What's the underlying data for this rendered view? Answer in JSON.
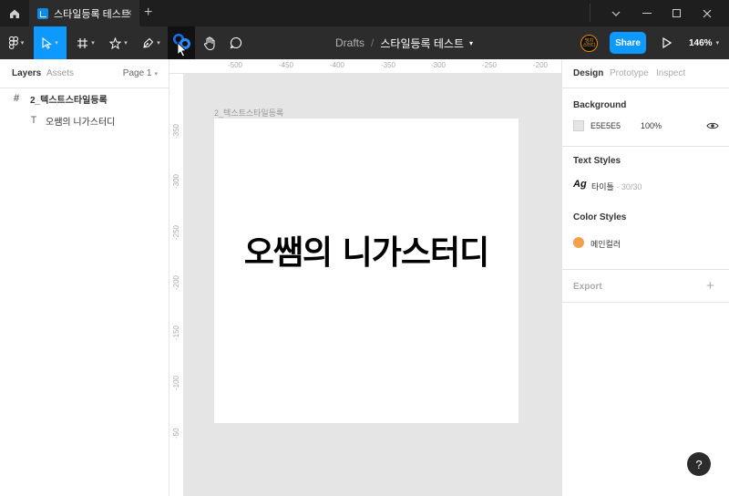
{
  "titlebar": {
    "tab_title": "스타일등록 테스트",
    "tab_close": "×",
    "new_tab": "+"
  },
  "toolbar": {
    "breadcrumb_parent": "Drafts",
    "breadcrumb_separator": "/",
    "file_name": "스타일등록 테스트",
    "avatar_text": "밍치\n스터디",
    "share_label": "Share",
    "zoom_label": "146%"
  },
  "left_panel": {
    "tabs": [
      "Layers",
      "Assets"
    ],
    "page_label": "Page 1",
    "layers": [
      {
        "name": "2_텍스트스타일등록",
        "icon": "#",
        "kind": "frame"
      },
      {
        "name": "오쌤의 니가스터디",
        "icon": "T",
        "kind": "text"
      }
    ]
  },
  "canvas": {
    "ruler_top": [
      "-500",
      "-450",
      "-400",
      "-350",
      "-300",
      "-250",
      "-200"
    ],
    "ruler_left": [
      "-350",
      "-300",
      "-250",
      "-200",
      "-150",
      "-100",
      "-50"
    ],
    "frame_label": "2_텍스트스타일등록",
    "frame_text": "오쌤의 니가스터디"
  },
  "right_panel": {
    "tabs": [
      "Design",
      "Prototype",
      "Inspect"
    ],
    "background": {
      "title": "Background",
      "hex": "E5E5E5",
      "opacity": "100%",
      "color": "#E5E5E5"
    },
    "text_styles": {
      "title": "Text Styles",
      "icon_text": "Ag",
      "style_name": "타이틀",
      "style_meta": " · 30/30"
    },
    "color_styles": {
      "title": "Color Styles",
      "style_name": "메인컬러",
      "color": "#F2A04A"
    },
    "export_title": "Export",
    "export_add": "+"
  },
  "help_label": "?"
}
